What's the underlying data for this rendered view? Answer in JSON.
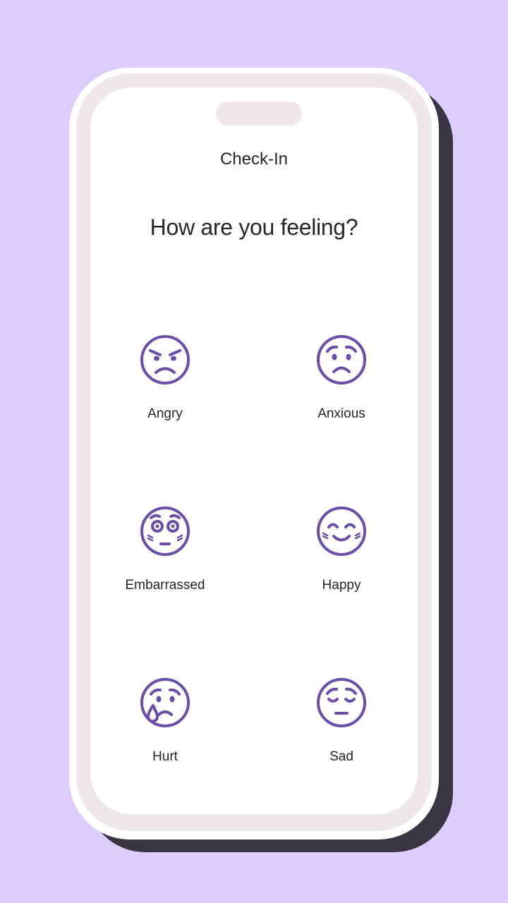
{
  "app": {
    "title": "Check-In"
  },
  "prompt": {
    "question": "How are you feeling?"
  },
  "moods": [
    {
      "label": "Angry",
      "icon": "angry-face-icon"
    },
    {
      "label": "Anxious",
      "icon": "anxious-face-icon"
    },
    {
      "label": "Embarrassed",
      "icon": "embarrassed-face-icon"
    },
    {
      "label": "Happy",
      "icon": "happy-face-icon"
    },
    {
      "label": "Hurt",
      "icon": "hurt-face-icon"
    },
    {
      "label": "Sad",
      "icon": "sad-face-icon"
    }
  ],
  "colors": {
    "background": "#dccdfb",
    "accent": "#6a4ea8",
    "text": "#26272c",
    "frame": "#efe7e9"
  }
}
